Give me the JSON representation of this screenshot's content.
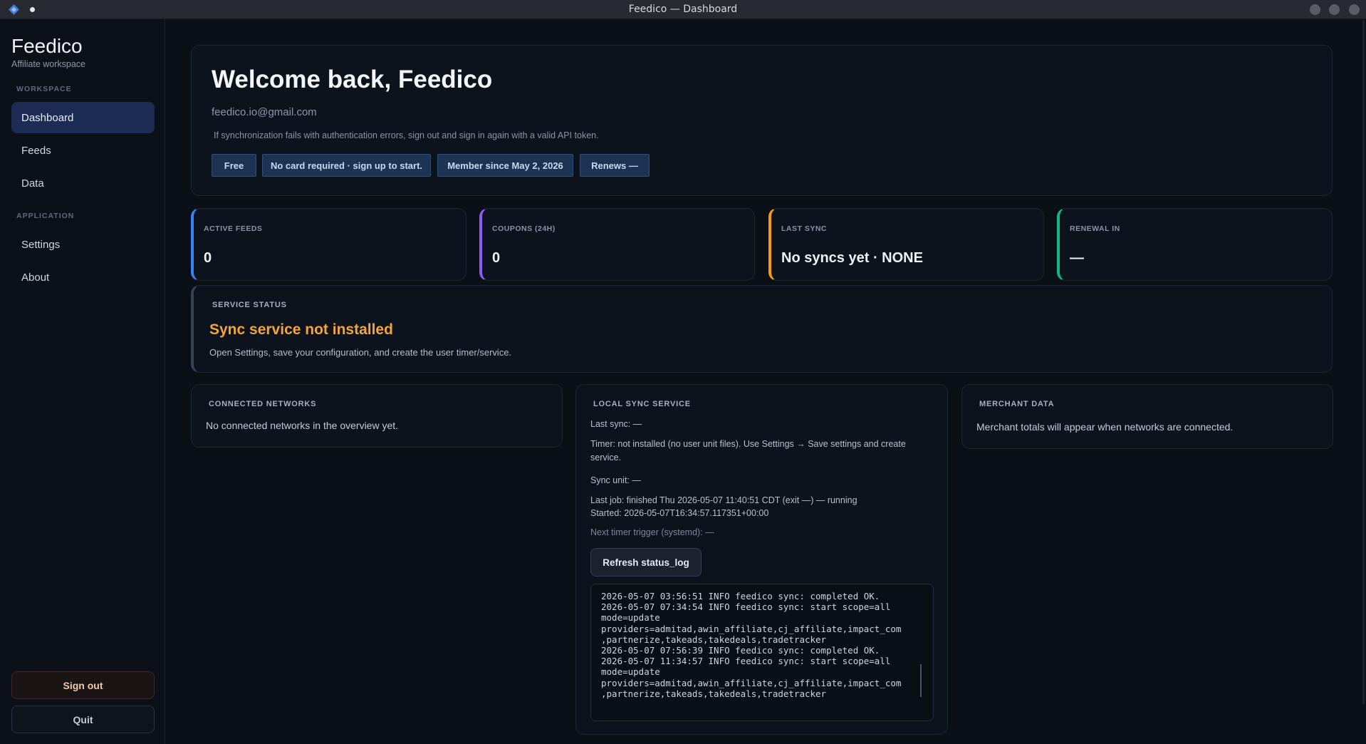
{
  "window": {
    "title": "Feedico — Dashboard"
  },
  "sidebar": {
    "brand": "Feedico",
    "subtitle": "Affiliate workspace",
    "sections": [
      {
        "label": "WORKSPACE",
        "items": [
          "Dashboard",
          "Feeds",
          "Data"
        ]
      },
      {
        "label": "APPLICATION",
        "items": [
          "Settings",
          "About"
        ]
      }
    ],
    "active_item": "Dashboard",
    "sign_out_label": "Sign out",
    "quit_label": "Quit"
  },
  "welcome": {
    "heading": "Welcome back, Feedico",
    "email": "feedico.io@gmail.com",
    "hint": "If synchronization fails with authentication errors, sign out and sign in again with a valid API token.",
    "pills": [
      "Free",
      "No card required · sign up to start.",
      "Member since May 2, 2026",
      "Renews —"
    ]
  },
  "stats": [
    {
      "label": "ACTIVE FEEDS",
      "value": "0",
      "accent": "#3b82f6"
    },
    {
      "label": "COUPONS (24H)",
      "value": "0",
      "accent": "#8b5cf6"
    },
    {
      "label": "LAST SYNC",
      "value": "No syncs yet · NONE",
      "accent": "#f59e0b"
    },
    {
      "label": "RENEWAL IN",
      "value": "—",
      "accent": "#10b981"
    }
  ],
  "service_status": {
    "label": "SERVICE STATUS",
    "status": "Sync service not installed",
    "description": "Open Settings, save your configuration, and create the user timer/service.",
    "status_color": "#f2a63a"
  },
  "connected_networks": {
    "label": "CONNECTED NETWORKS",
    "text": "No connected networks in the overview yet."
  },
  "local_sync": {
    "label": "LOCAL SYNC SERVICE",
    "last_sync": "Last sync: —",
    "timer": "Timer: not installed (no user unit files). Use Settings → Save settings and create service.",
    "sync_unit": "Sync unit: —",
    "last_job": "Last job: finished Thu 2026-05-07 11:40:51 CDT (exit —) — running",
    "started": "Started: 2026-05-07T16:34:57.117351+00:00",
    "next_trigger": "Next timer trigger (systemd): —",
    "refresh_label": "Refresh status_log",
    "log": "2026-05-07 03:56:51 INFO feedico sync: completed OK.\n2026-05-07 07:34:54 INFO feedico sync: start scope=all\nmode=update\nproviders=admitad,awin_affiliate,cj_affiliate,impact_com\n,partnerize,takeads,takedeals,tradetracker\n2026-05-07 07:56:39 INFO feedico sync: completed OK.\n2026-05-07 11:34:57 INFO feedico sync: start scope=all\nmode=update\nproviders=admitad,awin_affiliate,cj_affiliate,impact_com\n,partnerize,takeads,takedeals,tradetracker"
  },
  "merchant_data": {
    "label": "MERCHANT DATA",
    "text": "Merchant totals will appear when networks are connected."
  }
}
